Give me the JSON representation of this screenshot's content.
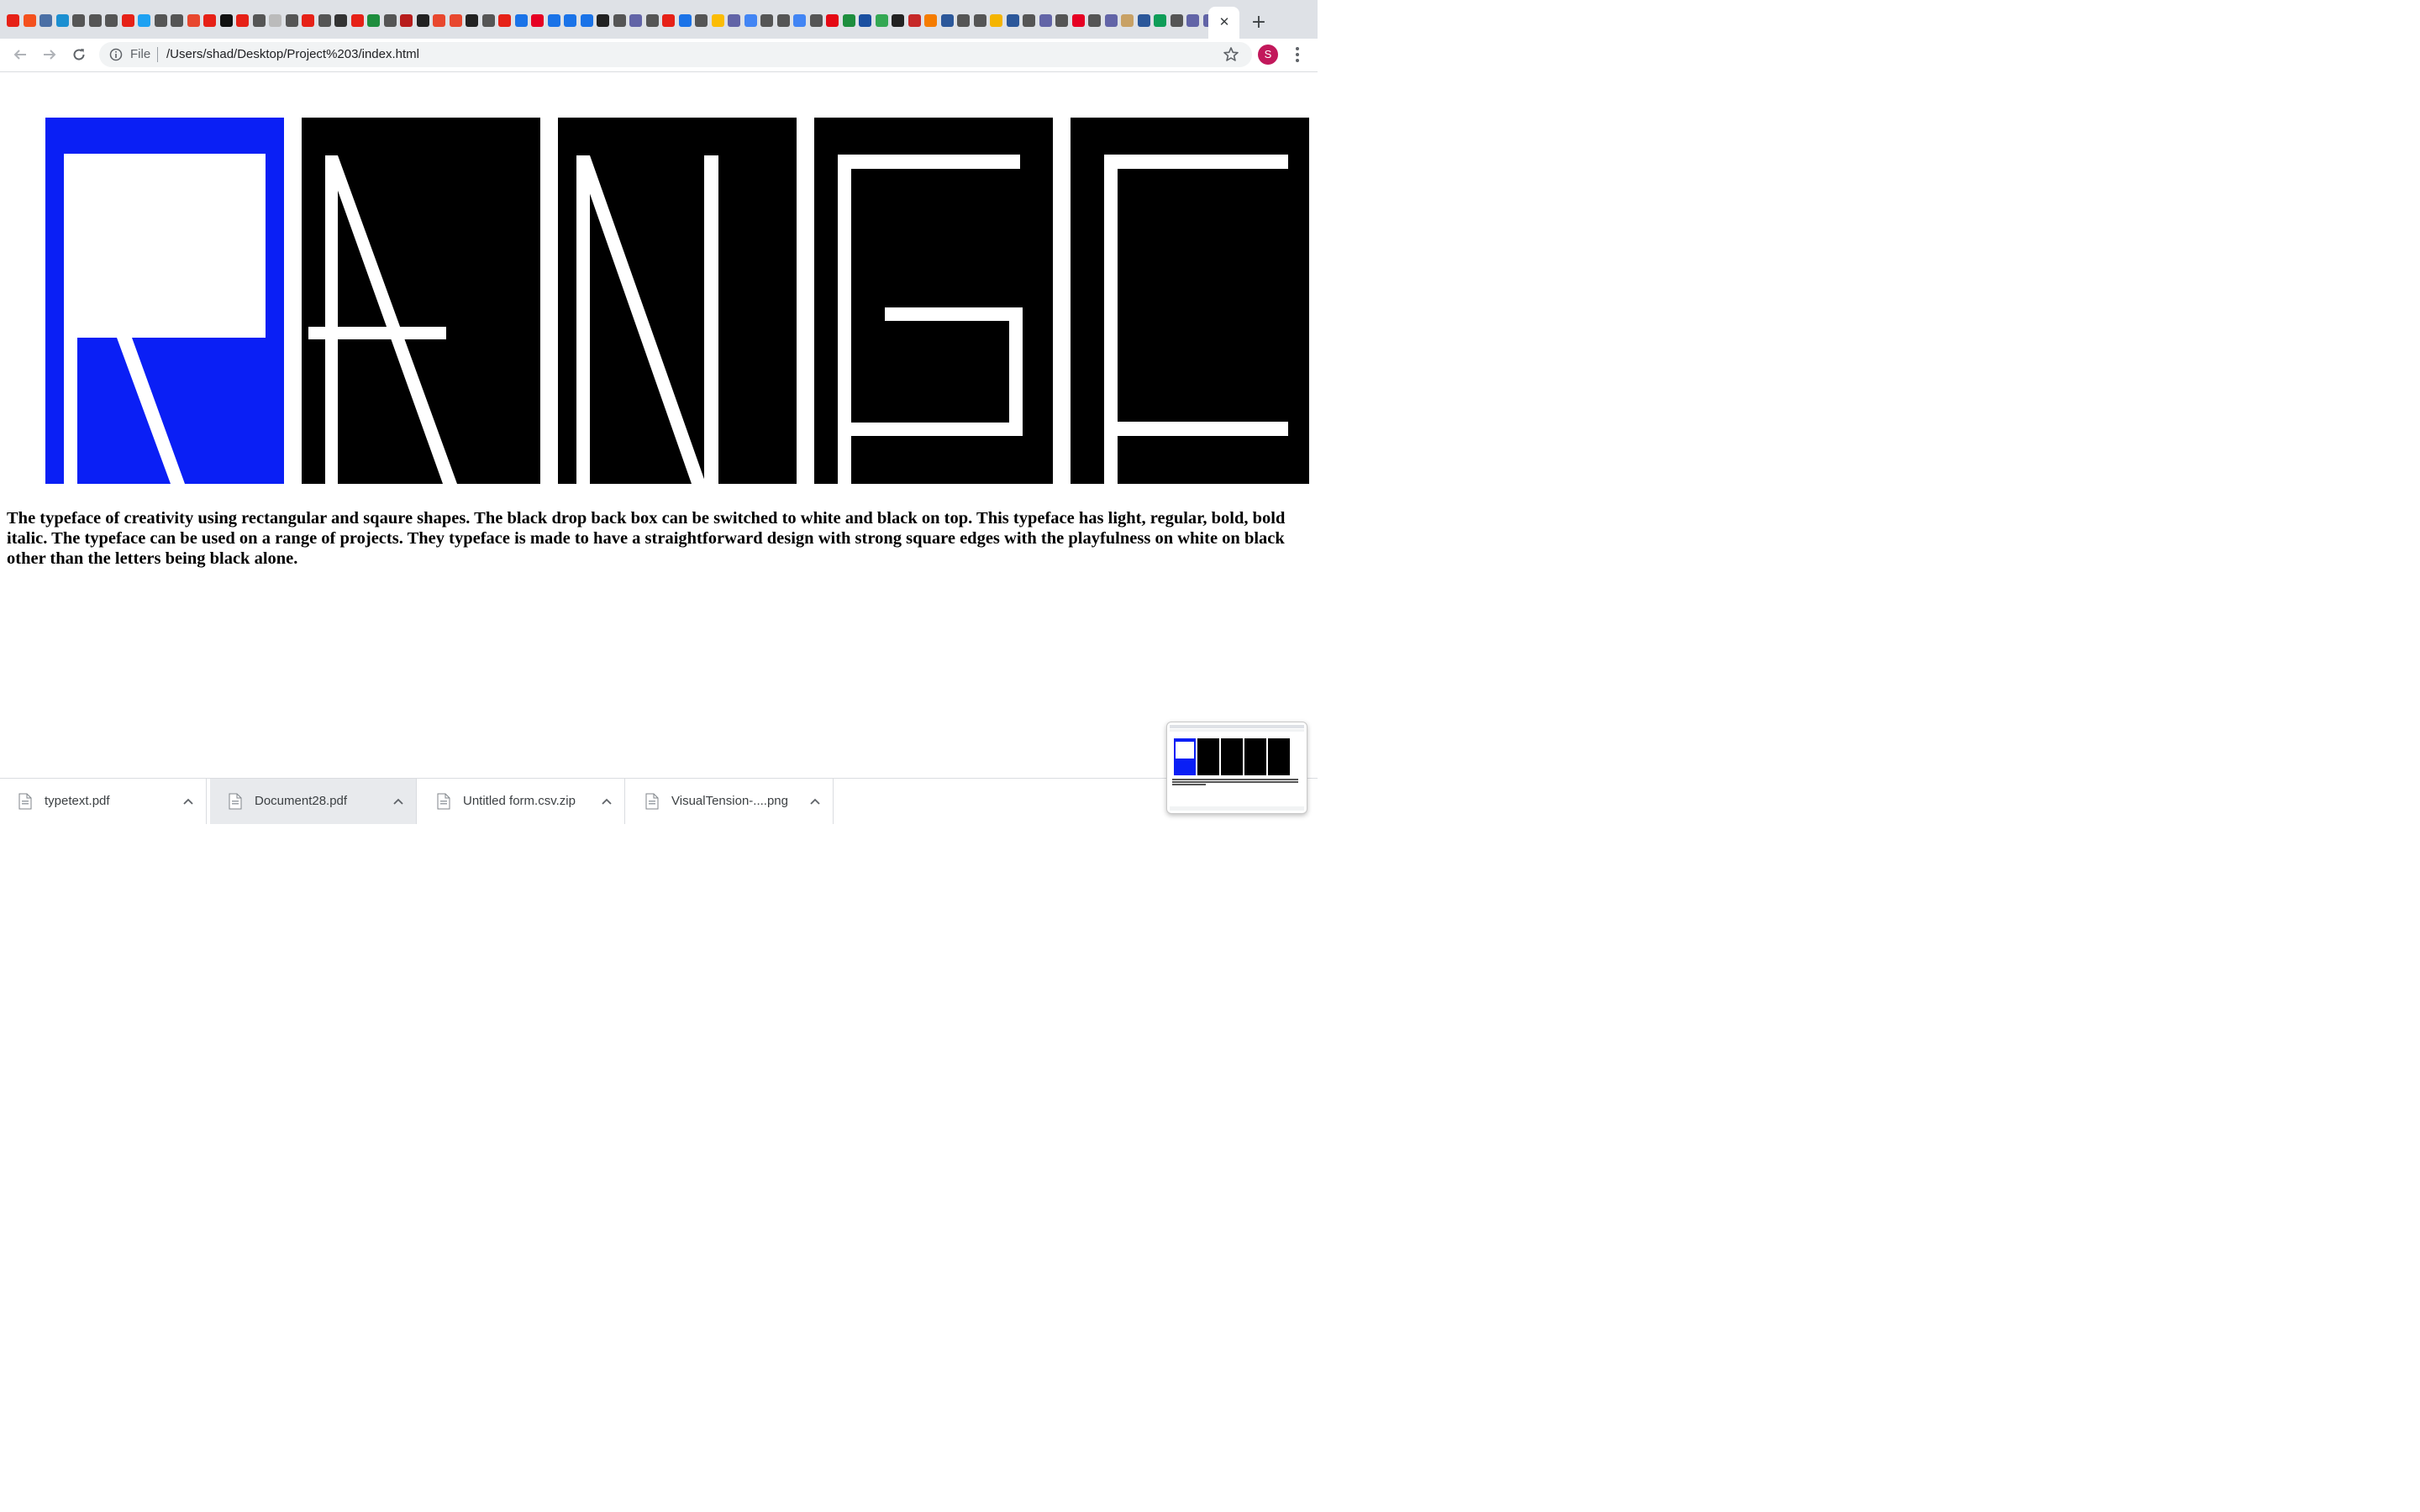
{
  "browser": {
    "favicon_colors": [
      "#e62117",
      "#f4511e",
      "#4a6fa5",
      "#1b8fd1",
      "#555555",
      "#555555",
      "#555555",
      "#e62117",
      "#1da1f2",
      "#555555",
      "#555555",
      "#e8472e",
      "#e62117",
      "#111111",
      "#e62117",
      "#555555",
      "#bbbbbb",
      "#555555",
      "#e62117",
      "#555555",
      "#333333",
      "#e62117",
      "#1e8e3e",
      "#555555",
      "#b71c1c",
      "#222222",
      "#e8472e",
      "#e8472e",
      "#222222",
      "#555555",
      "#e62117",
      "#1a73e8",
      "#e60023",
      "#1a73e8",
      "#1a73e8",
      "#1a73e8",
      "#222222",
      "#555555",
      "#6264a7",
      "#555555",
      "#e62117",
      "#1a73e8",
      "#555555",
      "#fbbc04",
      "#6264a7",
      "#4285f4",
      "#555555",
      "#555555",
      "#4285f4",
      "#555555",
      "#e50914",
      "#1e8e3e",
      "#1a4fa0",
      "#34a853",
      "#222222",
      "#c62828",
      "#f57c00",
      "#2b579a",
      "#555555",
      "#555555",
      "#f4b400",
      "#2b579a",
      "#555555",
      "#6264a7",
      "#555555",
      "#e60023",
      "#555555",
      "#6264a7",
      "#c8a165",
      "#2b579a",
      "#0f9d58",
      "#555555",
      "#6264a7",
      "#6264a7"
    ],
    "active_tab_close": "✕",
    "new_tab": "+",
    "file_chip": "File",
    "url": "/Users/shad/Desktop/Project%203/index.html",
    "profile_initial": "S"
  },
  "page": {
    "logo": {
      "letters": [
        "R",
        "A",
        "N",
        "G",
        "E"
      ],
      "colors": {
        "accent_box": "#0a1ff5",
        "dark_box": "#000000",
        "stroke": "#ffffff"
      }
    },
    "description": "The typeface of creativity using rectangular and sqaure shapes. The black drop back box can be switched to white and black on top. This typeface has light, regular, bold, bold italic. The typeface can be used on a range of projects. They typeface is made to have a straightforward design with strong square edges with the playfulness on white on black other than the letters being black alone."
  },
  "downloads": [
    {
      "name": "typetext.pdf",
      "icon": "pdf-file-icon"
    },
    {
      "name": "Document28.pdf",
      "icon": "pdf-file-icon"
    },
    {
      "name": "Untitled form.csv.zip",
      "icon": "zip-file-icon"
    },
    {
      "name": "VisualTension-....png",
      "icon": "png-file-icon"
    }
  ]
}
